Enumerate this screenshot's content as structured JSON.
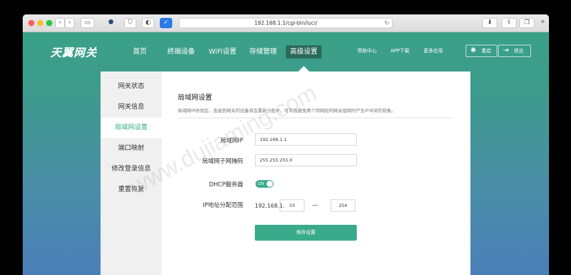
{
  "browser": {
    "url": "192.168.1.1/cgi-bin/luci/",
    "traffic_light_colors": [
      "#fd5f57",
      "#febc2e",
      "#28c840"
    ]
  },
  "nav": {
    "logo": "天翼网关",
    "items": [
      {
        "label": "首页"
      },
      {
        "label": "终端设备"
      },
      {
        "label": "WiFi设置"
      },
      {
        "label": "存储管理"
      },
      {
        "label": "高级设置",
        "active": true
      }
    ],
    "links": {
      "help": "帮助中心",
      "app": "APP下载",
      "more": "更多应用"
    },
    "restart": "重启",
    "logout": "退出"
  },
  "sidebar": {
    "items": [
      {
        "label": "网关状态"
      },
      {
        "label": "网关信息"
      },
      {
        "label": "局域网设置",
        "active": true
      },
      {
        "label": "端口映射"
      },
      {
        "label": "修改登录信息"
      },
      {
        "label": "重置恢复"
      }
    ]
  },
  "form": {
    "title": "局域网设置",
    "description": "局域网IP修改后，连接到网关的设备将会重新分配IP，可有效避免两个同网段的网关组网时产生IP冲突的现象。",
    "lan_ip_label": "局域网IP",
    "lan_ip_value": "192.168.1.1",
    "subnet_label": "局域网子网掩码",
    "subnet_value": "255.255.255.0",
    "dhcp_label": "DHCP服务器",
    "dhcp_state": "ON",
    "range_label": "IP地址分配范围",
    "range_prefix": "192.168.1.",
    "range_start": "33",
    "range_separator": "—",
    "range_end": "254",
    "save_label": "保存设置"
  },
  "watermark": "www.dujiaming.com",
  "colors": {
    "accent": "#3aab8a",
    "nav_active_bg": "#2a6a5a"
  }
}
